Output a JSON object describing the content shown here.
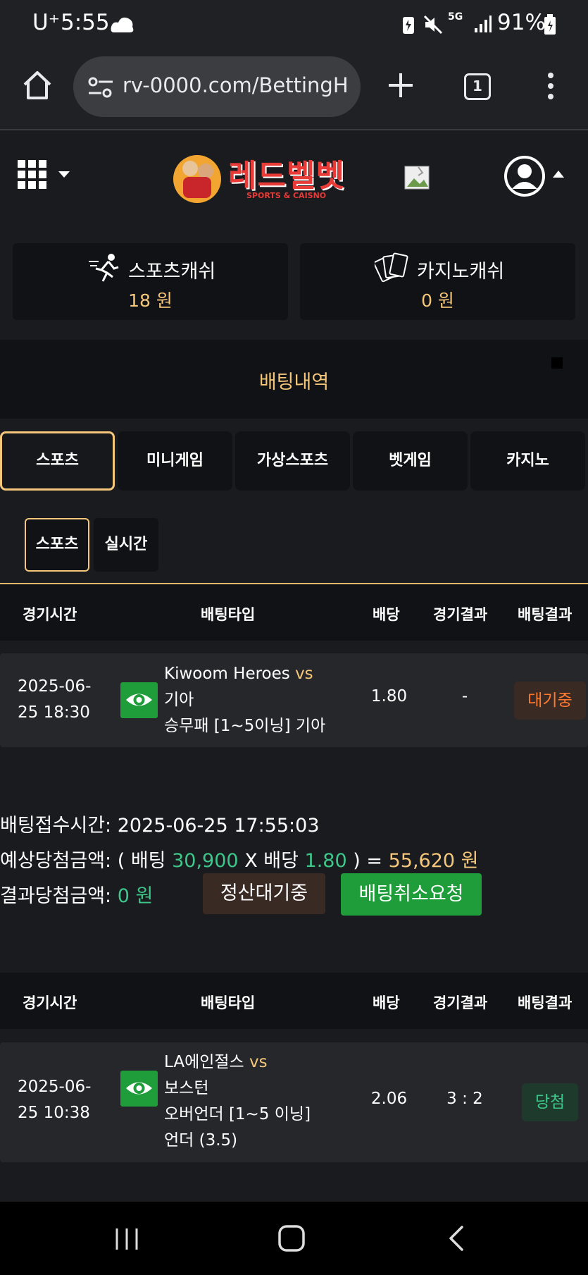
{
  "status_bar": {
    "carrier": "U⁺",
    "time": "5:55",
    "battery": "91%",
    "network": "5G"
  },
  "browser": {
    "url": "rv-0000.com/BettingH",
    "tab_count": "1"
  },
  "site": {
    "logo_main": "레드벨벳",
    "logo_sub": "SPORTS & CAISNO"
  },
  "wallet": {
    "sports_label": "스포츠캐쉬",
    "sports_value": "18 원",
    "casino_label": "카지노캐쉬",
    "casino_value": "0 원"
  },
  "page_title": "배팅내역",
  "tabs": [
    {
      "label": "스포츠",
      "active": true
    },
    {
      "label": "미니게임"
    },
    {
      "label": "가상스포츠"
    },
    {
      "label": "벳게임"
    },
    {
      "label": "카지노"
    }
  ],
  "subtabs": [
    {
      "label": "스포츠",
      "active": true
    },
    {
      "label": "실시간"
    }
  ],
  "columns": [
    "경기시간",
    "배팅타입",
    "배당",
    "경기결과",
    "배팅결과"
  ],
  "bets": [
    {
      "date_line1": "2025-06-",
      "date_line2": "25 18:30",
      "home": "Kiwoom Heroes",
      "vs": "vs",
      "away": "기아",
      "market": "승무패 [1~5이닝] 기아",
      "odds": "1.80",
      "result": "-",
      "status": "대기중",
      "receipt_label": "배팅접수시간:",
      "receipt_time": "2025-06-25 17:55:03",
      "expected_label": "예상당첨금액: ( 배팅",
      "stake": "30,900",
      "x_label": "X 배당",
      "odds_again": "1.80",
      "eq_label": ") =",
      "payout": "55,620 원",
      "result_amount_label": "결과당첨금액:",
      "result_amount": "0 원",
      "settle_btn": "정산대기중",
      "cancel_btn": "배팅취소요청"
    },
    {
      "date_line1": "2025-06-",
      "date_line2": "25 10:38",
      "home": "LA에인절스",
      "vs": "vs",
      "away": "보스턴",
      "market_line1": "오버언더 [1~5 이닝]",
      "market_line2": "언더 (3.5)",
      "odds": "2.06",
      "result": "3 : 2",
      "status": "당첨"
    }
  ],
  "colors": {
    "gold": "#f5c77a",
    "green": "#3ec78a",
    "button_green": "#1e9d3a",
    "pending_orange": "#ff7a2e"
  }
}
